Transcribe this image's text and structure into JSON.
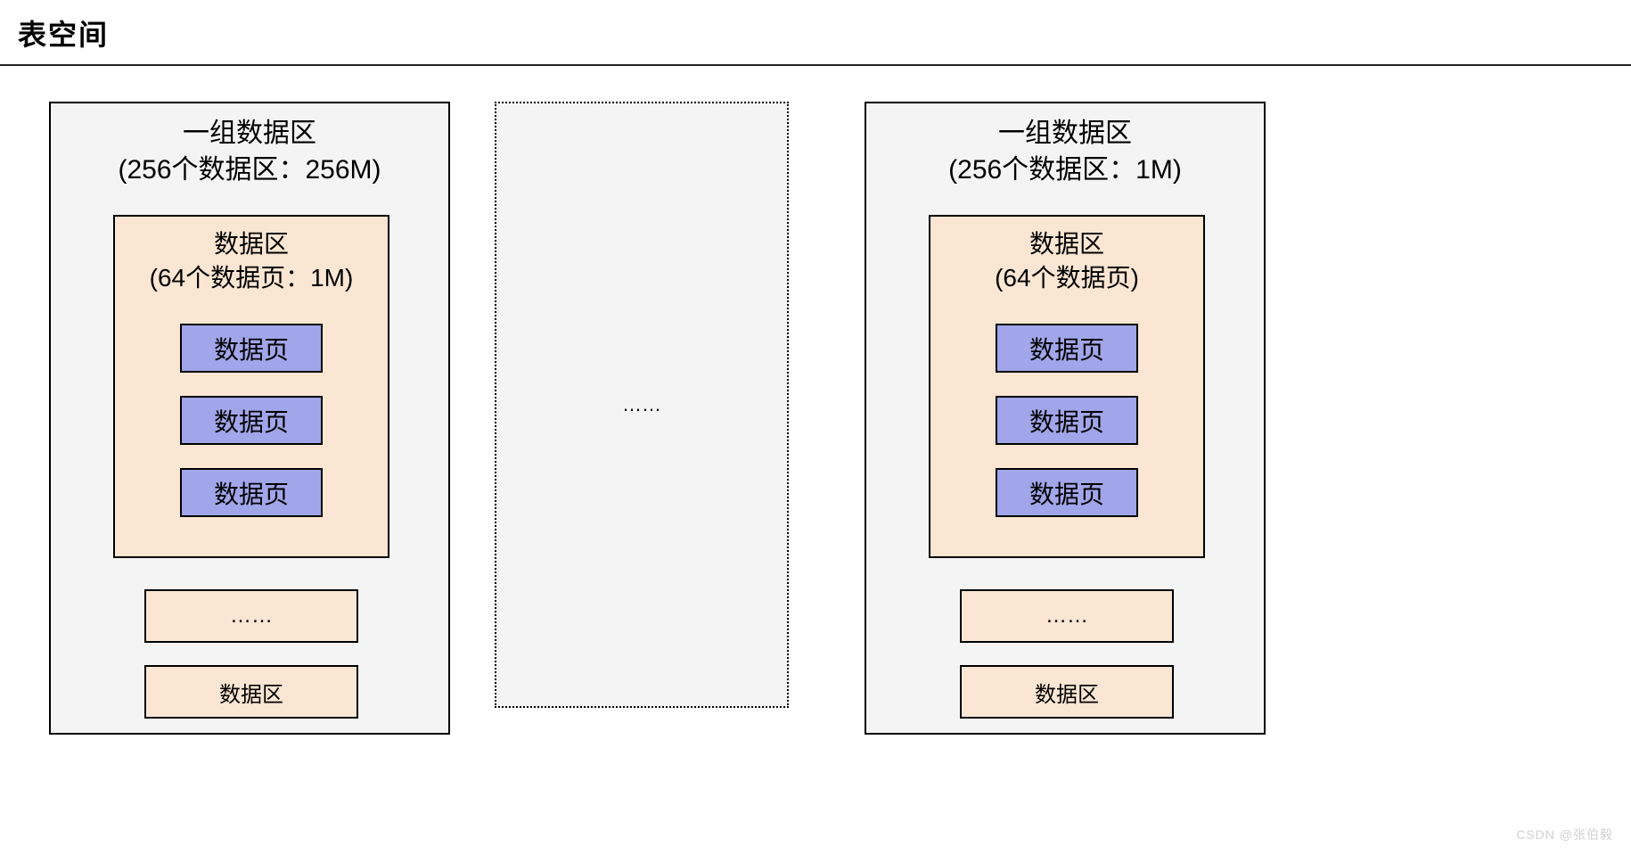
{
  "title": "表空间",
  "left": {
    "group_title_line1": "一组数据区",
    "group_title_line2": "(256个数据区：256M)",
    "extent_title_line1": "数据区",
    "extent_title_line2": "(64个数据页：1M)",
    "page1": "数据页",
    "page2": "数据页",
    "page3": "数据页",
    "ellipsis_box": "……",
    "more_extent": "数据区"
  },
  "middle": {
    "ellipsis": "……"
  },
  "right": {
    "group_title_line1": "一组数据区",
    "group_title_line2": "(256个数据区：1M)",
    "extent_title_line1": "数据区",
    "extent_title_line2": "(64个数据页)",
    "page1": "数据页",
    "page2": "数据页",
    "page3": "数据页",
    "ellipsis_box": "……",
    "more_extent": "数据区"
  },
  "watermark": "CSDN @张伯毅"
}
